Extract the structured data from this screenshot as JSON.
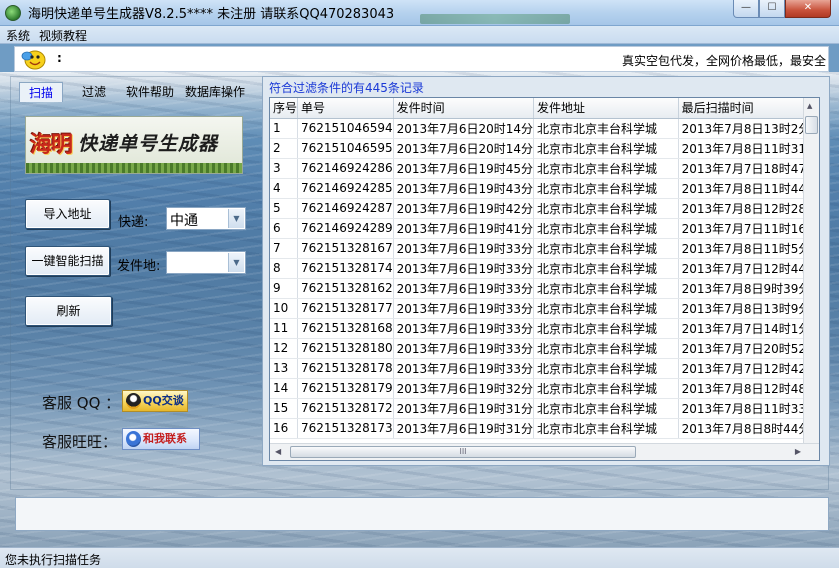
{
  "window": {
    "title": "海明快递单号生成器V8.2.5****  未注册 请联系QQ470283043",
    "controls": {
      "minimize": "—",
      "maximize": "☐",
      "close": "✕"
    }
  },
  "menu": {
    "items": [
      "系统",
      "视频教程"
    ]
  },
  "toolbar": {
    "colon": ":",
    "marquee": "真实空包代发，全网价格最低，最安全"
  },
  "tabs": [
    {
      "label": "扫描",
      "active": true
    },
    {
      "label": "过滤",
      "active": false
    },
    {
      "label": "软件帮助",
      "active": false
    },
    {
      "label": "数据库操作",
      "active": false
    }
  ],
  "logo": {
    "big": "海明",
    "rest": "快递单号生成器"
  },
  "controls": {
    "import_label": "导入地址",
    "scan_label": "一键智能扫描",
    "refresh_label": "刷新",
    "express_label": "快递:",
    "express_value": "中通",
    "origin_label": "发件地:",
    "origin_value": ""
  },
  "service": {
    "qq_label": "客服 QQ ：",
    "qq_badge": "QQ交谈",
    "ww_label": "客服旺旺：",
    "ww_badge": "和我联系"
  },
  "grid": {
    "records_text": "符合过滤条件的有445条记录",
    "columns": [
      "序号",
      "单号",
      "发件时间",
      "发件地址",
      "最后扫描时间"
    ],
    "rows": [
      [
        "1",
        "762151046594",
        "2013年7月6日20时14分",
        "北京市北京丰台科学城",
        "2013年7月8日13时2分"
      ],
      [
        "2",
        "762151046595",
        "2013年7月6日20时14分",
        "北京市北京丰台科学城",
        "2013年7月8日11时31分"
      ],
      [
        "3",
        "762146924286",
        "2013年7月6日19时45分",
        "北京市北京丰台科学城",
        "2013年7月7日18时47分"
      ],
      [
        "4",
        "762146924285",
        "2013年7月6日19时43分",
        "北京市北京丰台科学城",
        "2013年7月8日11时44分"
      ],
      [
        "5",
        "762146924287",
        "2013年7月6日19时42分",
        "北京市北京丰台科学城",
        "2013年7月8日12时28分"
      ],
      [
        "6",
        "762146924289",
        "2013年7月6日19时41分",
        "北京市北京丰台科学城",
        "2013年7月7日11时16分"
      ],
      [
        "7",
        "762151328167",
        "2013年7月6日19时33分",
        "北京市北京丰台科学城",
        "2013年7月8日11时5分"
      ],
      [
        "8",
        "762151328174",
        "2013年7月6日19时33分",
        "北京市北京丰台科学城",
        "2013年7月7日12时44分"
      ],
      [
        "9",
        "762151328162",
        "2013年7月6日19时33分",
        "北京市北京丰台科学城",
        "2013年7月8日9时39分"
      ],
      [
        "10",
        "762151328177",
        "2013年7月6日19时33分",
        "北京市北京丰台科学城",
        "2013年7月8日13时9分"
      ],
      [
        "11",
        "762151328168",
        "2013年7月6日19时33分",
        "北京市北京丰台科学城",
        "2013年7月7日14时1分"
      ],
      [
        "12",
        "762151328180",
        "2013年7月6日19时33分",
        "北京市北京丰台科学城",
        "2013年7月7日20时52分"
      ],
      [
        "13",
        "762151328178",
        "2013年7月6日19时33分",
        "北京市北京丰台科学城",
        "2013年7月7日12时42分"
      ],
      [
        "14",
        "762151328179",
        "2013年7月6日19时32分",
        "北京市北京丰台科学城",
        "2013年7月8日12时48分"
      ],
      [
        "15",
        "762151328172",
        "2013年7月6日19时31分",
        "北京市北京丰台科学城",
        "2013年7月8日11时33分"
      ],
      [
        "16",
        "762151328173",
        "2013年7月6日19时31分",
        "北京市北京丰台科学城",
        "2013年7月8日8时44分"
      ]
    ],
    "hscroll_grip": "III"
  },
  "status": {
    "text": "您未执行扫描任务"
  },
  "colors": {
    "accent": "#1a39d6",
    "tab_active": "#0000ee"
  },
  "icons": [
    "app-icon",
    "smile-icon",
    "qq-icon",
    "wangwang-icon",
    "dropdown-arrow-icon"
  ]
}
